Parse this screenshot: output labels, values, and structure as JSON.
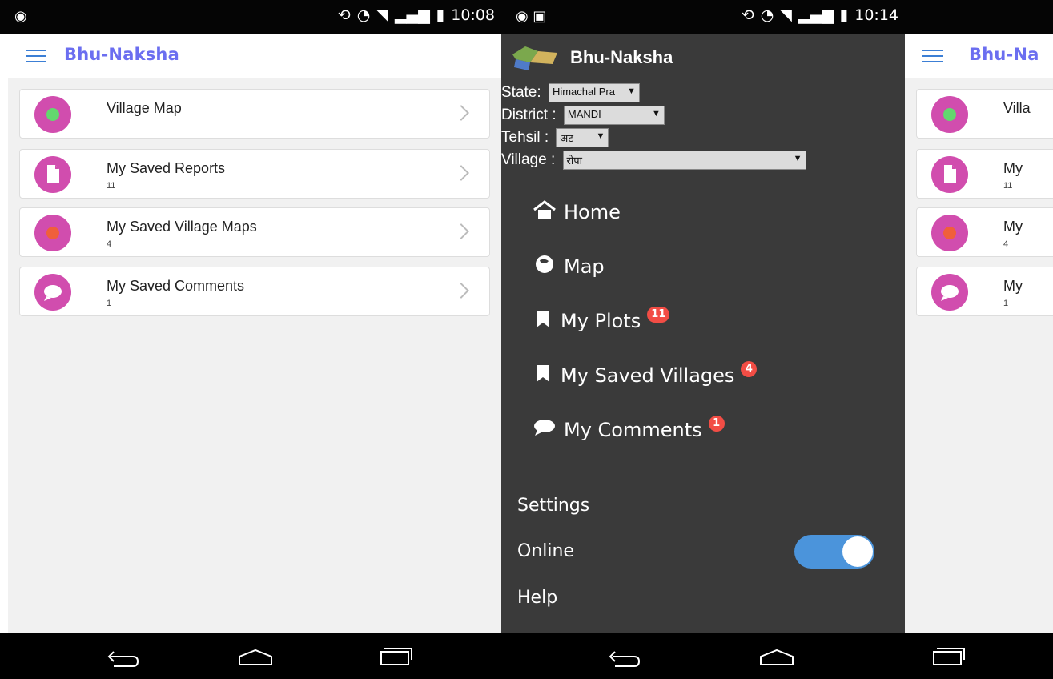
{
  "screens": [
    {
      "status_time": "10:08",
      "app_title": "Bhu-Naksha",
      "cards": [
        {
          "title": "Village Map",
          "count": "",
          "icon": "globe-icon"
        },
        {
          "title": "My Saved Reports",
          "count": "11",
          "icon": "document-icon"
        },
        {
          "title": "My Saved Village Maps",
          "count": "4",
          "icon": "map-pin-icon"
        },
        {
          "title": "My Saved Comments",
          "count": "1",
          "icon": "speech-bubble-icon"
        }
      ]
    },
    {
      "status_time": "10:14",
      "drawer": {
        "title": "Bhu-Naksha",
        "fields": {
          "state": {
            "label": "State:",
            "value": "Himachal Pra"
          },
          "district": {
            "label": "District :",
            "value": "MANDI"
          },
          "tehsil": {
            "label": "Tehsil :",
            "value": "अट"
          },
          "village": {
            "label": "Village :",
            "value": "रोपा"
          }
        },
        "menu": [
          {
            "label": "Home",
            "icon": "home-icon"
          },
          {
            "label": "Map",
            "icon": "globe-icon"
          },
          {
            "label": "My Plots",
            "badge": "11",
            "icon": "bookmark-icon"
          },
          {
            "label": "My Saved Villages",
            "badge": "4",
            "icon": "bookmark-icon"
          },
          {
            "label": "My Comments",
            "badge": "1",
            "icon": "speech-bubble-icon"
          }
        ],
        "settings_label": "Settings",
        "online_label": "Online",
        "help_label": "Help"
      }
    },
    {
      "app_title": "Bhu-Na",
      "cards": [
        {
          "title": "Villa",
          "count": ""
        },
        {
          "title": "My",
          "count": "11"
        },
        {
          "title": "My",
          "count": "4"
        },
        {
          "title": "My",
          "count": "1"
        }
      ]
    }
  ]
}
